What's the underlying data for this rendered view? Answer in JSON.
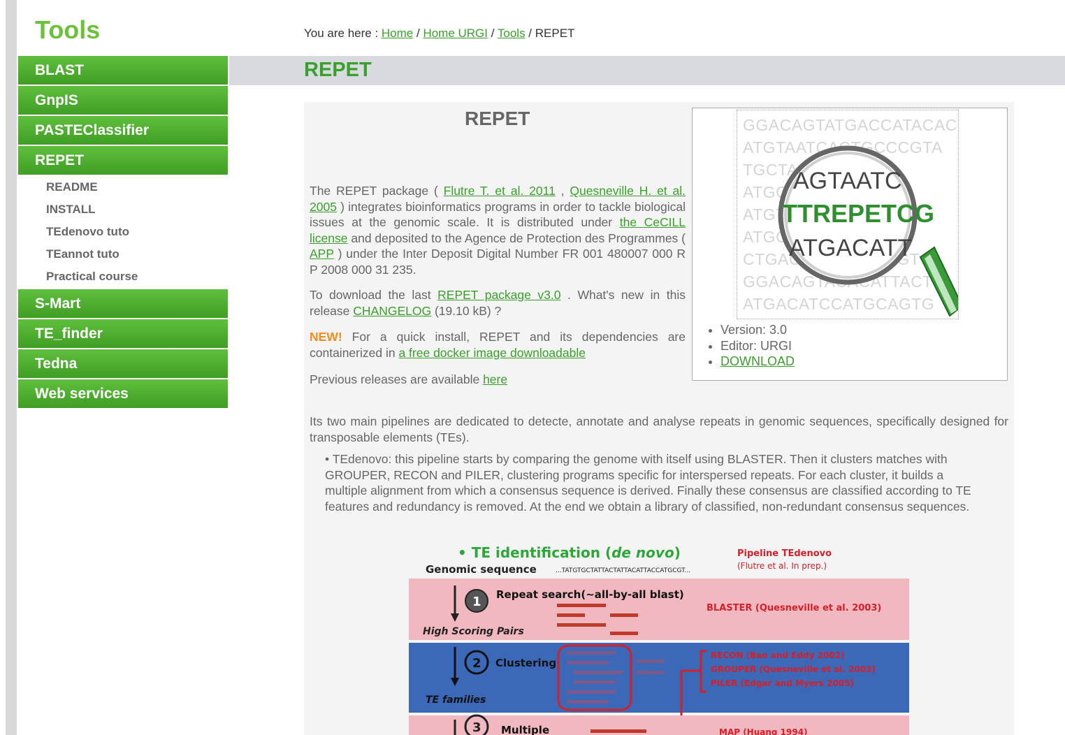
{
  "sidebar": {
    "title": "Tools",
    "items": [
      {
        "label": "BLAST"
      },
      {
        "label": "GnpIS"
      },
      {
        "label": "PASTEClassifier"
      },
      {
        "label": "REPET",
        "subitems": [
          {
            "label": "README"
          },
          {
            "label": "INSTALL"
          },
          {
            "label": "TEdenovo tuto"
          },
          {
            "label": "TEannot tuto"
          },
          {
            "label": "Practical course"
          }
        ]
      },
      {
        "label": "S-Mart"
      },
      {
        "label": "TE_finder"
      },
      {
        "label": "Tedna"
      },
      {
        "label": "Web services"
      }
    ]
  },
  "breadcrumb": {
    "prefix": "You are here : ",
    "links": [
      "Home",
      "Home URGI",
      "Tools"
    ],
    "sep": " / ",
    "current": "REPET"
  },
  "page_title": "REPET",
  "content": {
    "title": "REPET",
    "intro": {
      "t1": "The REPET package ( ",
      "link1": "Flutre T. et al. 2011",
      "t2": " , ",
      "link2": "Quesneville H. et al. 2005",
      "t3": " ) integrates bioinformatics programs in order to tackle biological issues at the genomic scale. It is distributed under ",
      "link3": "the CeCILL license",
      "t4": " and deposited to the Agence de Protection des Programmes ( ",
      "link4": "APP",
      "t5": " ) under the Inter Deposit Digital Number FR 001 480007 000 R P 2008 000 31 235."
    },
    "download": {
      "t1": "To download the last ",
      "link1": "REPET package v3.0",
      "t2": " . What's new in this release ",
      "link2": "CHANGELOG",
      "t3": " (19.10 kB) ?"
    },
    "new": {
      "badge": "NEW!",
      "t1": " For a quick install, REPET and its dependencies are containerized in ",
      "link": "a free docker image downloadable"
    },
    "previous": {
      "t1": "Previous releases are available ",
      "link": "here"
    },
    "pipelines": "Its two main pipelines are dedicated to detecte, annotate and analyse repeats in genomic sequences, specifically designed for transposable elements (TEs).",
    "tedenovo": "TEdenovo: this pipeline starts by comparing the genome with itself using BLASTER. Then it clusters matches with GROUPER, RECON and PILER, clustering programs specific for interspersed repeats. For each cluster, it builds a multiple alignment from which a consensus sequence is derived. Finally these consensus are classified according to TE features and redundancy is removed. At the end we obtain a library of classified, non-redundant consensus sequences."
  },
  "infobox": {
    "logo_rows": [
      "GGACAGTATGACCATACACCT",
      "ATGTAATCACTGCCCGTA",
      "TGCTAGTAATCAAG",
      "ATGCAGTAATCATG",
      "ATGTTREPETCGATC",
      "ATGCATGACATTAAC",
      "CTGACATGACATTAGT",
      "GGACAGTACACATTACT",
      "ATGACATCCATGCAGTG"
    ],
    "logo_lens": [
      "AGTAATC",
      "TTREPETCG",
      "ATGACATT"
    ],
    "version": "Version: 3.0",
    "editor": "Editor: URGI",
    "download": "DOWNLOAD"
  },
  "diagram": {
    "heading_prefix": "• TE identification (",
    "heading_italic": "de novo",
    "heading_suffix": ")",
    "pipeline_title": "Pipeline TEdenovo",
    "pipeline_ref": "(Flutre et al. In prep.)",
    "genomic": "Genomic sequence",
    "genomic_seq": "...TATGTGCTATTACTATTACATTACCATGCGT...",
    "step1_num": "1",
    "step1_label": "Repeat search(~all-by-all blast)",
    "step1_output": "High Scoring Pairs",
    "blaster_ref": "BLASTER (Quesneville et al. 2003)",
    "step2_num": "2",
    "step2_label": "Clustering",
    "step2_output": "TE families",
    "recon_ref": "RECON (Bao and Eddy 2002)",
    "grouper_ref": "GROUPER (Quesneville et al. 2003)",
    "piler_ref": "PILER (Edgar and Myers 2005)",
    "step3_num": "3",
    "step3_label": "Multiple",
    "map_ref": "MAP (Huang 1994)",
    "colors": {
      "pink": "#f2b8bf",
      "blue": "#3c68b8",
      "red": "#d4202a",
      "green": "#2fa63a"
    }
  }
}
